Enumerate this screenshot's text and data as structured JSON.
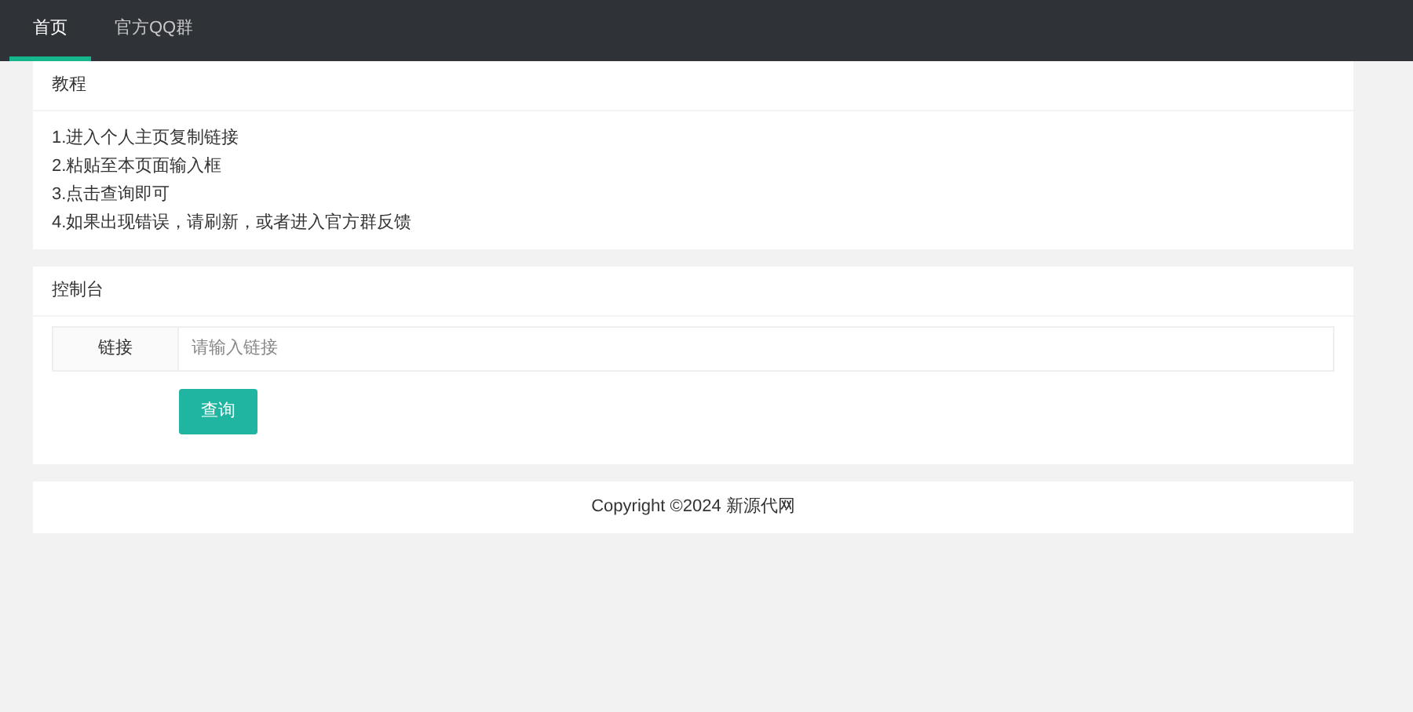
{
  "nav": {
    "tabs": [
      {
        "label": "首页",
        "selected": true
      },
      {
        "label": "官方QQ群",
        "selected": false
      }
    ]
  },
  "tutorial": {
    "title": "教程",
    "steps": [
      "1.进入个人主页复制链接",
      "2.粘贴至本页面输入框",
      "3.点击查询即可",
      "4.如果出现错误，请刷新，或者进入官方群反馈"
    ]
  },
  "console": {
    "title": "控制台",
    "field_label": "链接",
    "placeholder": "请输入链接",
    "button": "查询"
  },
  "footer": {
    "text": "Copyright ©2024 新源代网"
  }
}
